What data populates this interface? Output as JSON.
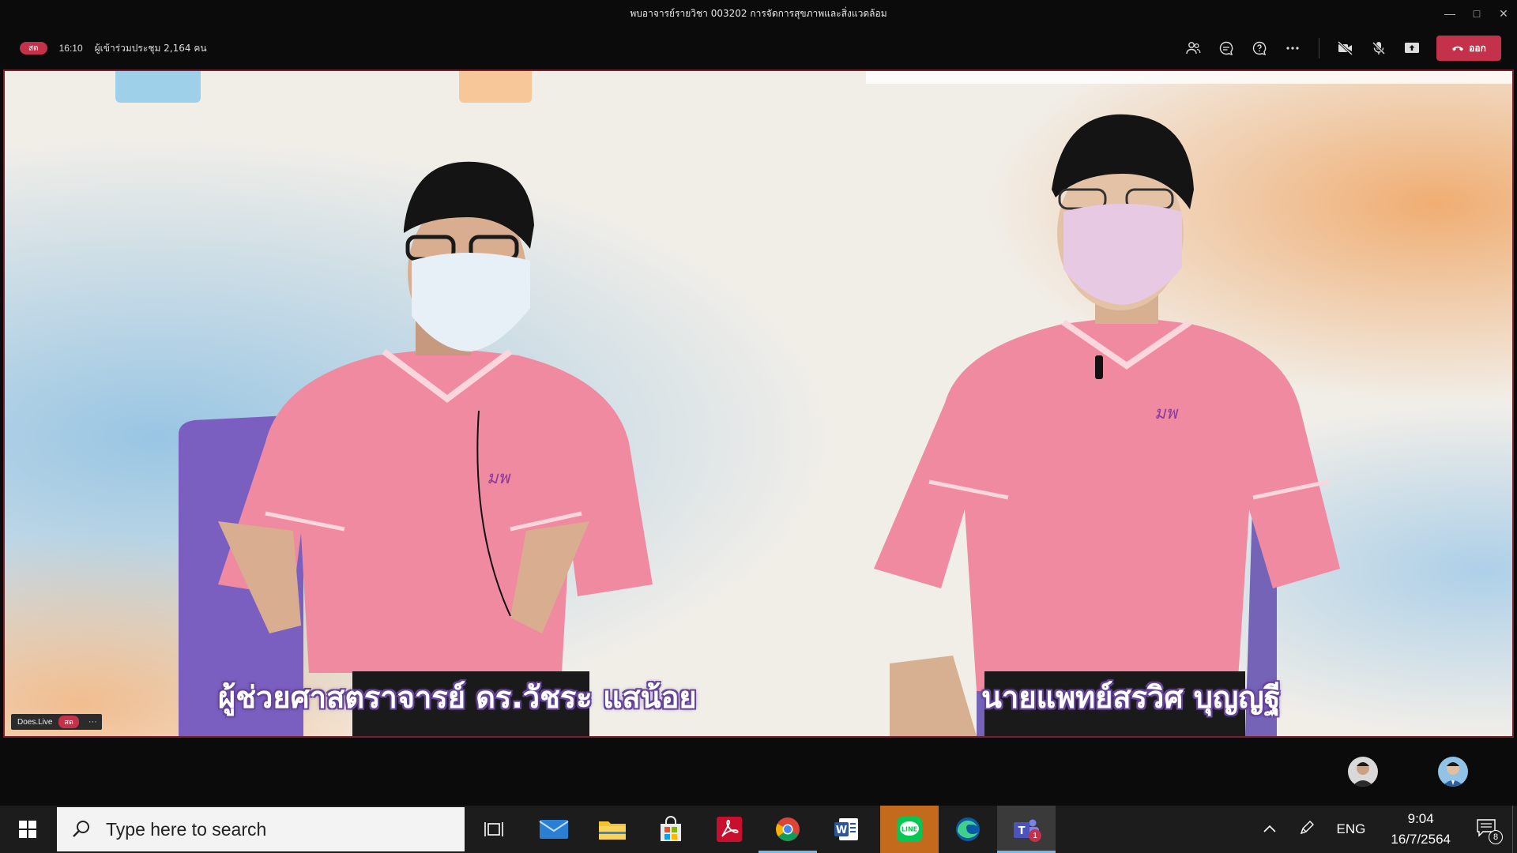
{
  "window": {
    "title": "พบอาจารย์รายวิชา 003202 การจัดการสุขภาพและสิ่งแวดล้อม"
  },
  "meeting": {
    "live_label": "สด",
    "elapsed": "16:10",
    "attendees": "ผู้เข้าร่วมประชุม 2,164 คน",
    "leave_label": "ออก"
  },
  "stage": {
    "caption_left": "ผู้ช่วยศาสตราจารย์ ดร.วัชระ แสน้อย",
    "caption_right": "นายแพทย์สรวิศ บุญญฐี",
    "overlay_name": "Does.Live",
    "overlay_live": "สด",
    "overlay_more": "···"
  },
  "taskbar": {
    "search_placeholder": "Type here to search",
    "language": "ENG",
    "time": "9:04",
    "date": "16/7/2564",
    "notifications": "8",
    "teams_badge": "1",
    "apps": [
      "task-view",
      "mail",
      "file-explorer",
      "microsoft-store",
      "acrobat",
      "chrome",
      "word",
      "line",
      "edge",
      "teams"
    ]
  },
  "colors": {
    "live_red": "#c4314b",
    "shirt_pink": "#f08aa0",
    "chair_purple": "#7a5fc0",
    "caption_outline": "#6b4aa0"
  }
}
